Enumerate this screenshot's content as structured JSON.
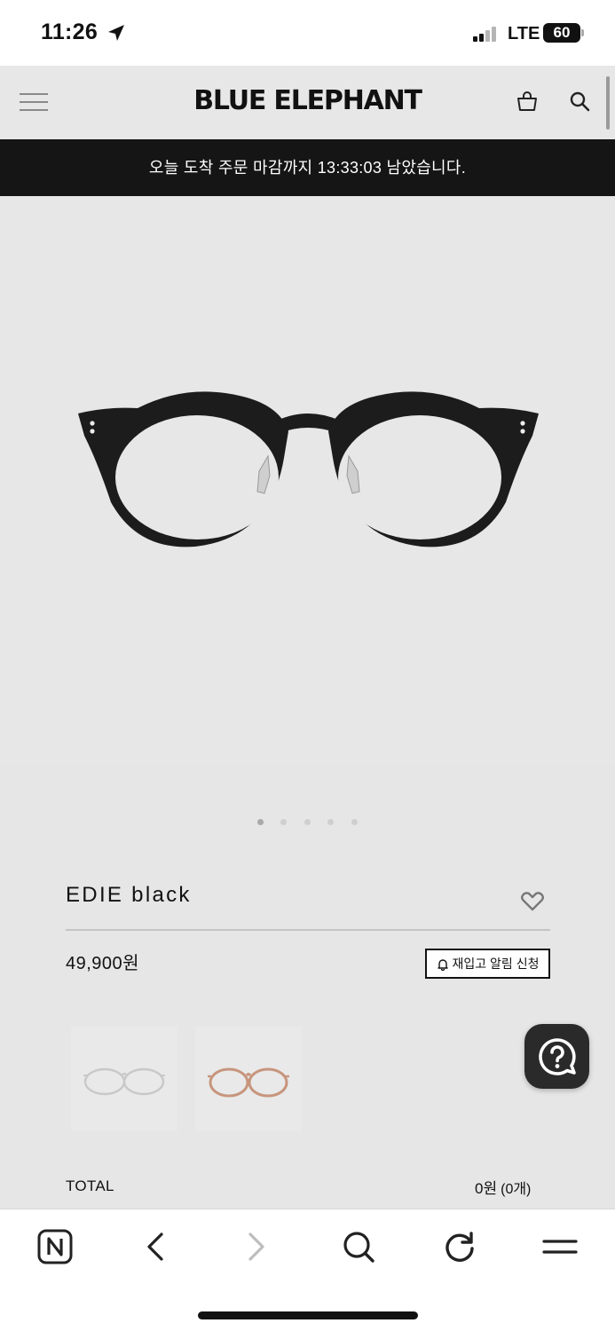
{
  "status_bar": {
    "time": "11:26",
    "network": "LTE",
    "battery": "60"
  },
  "header": {
    "brand": "BLUE ELEPHANT",
    "icons": [
      "menu-icon",
      "shopping-bag-icon",
      "search-icon"
    ]
  },
  "banner": {
    "text": "오늘 도착 주문 마감까지 13:33:03 남았습니다."
  },
  "gallery": {
    "image_count": 5,
    "active_index": 0
  },
  "product": {
    "name": "EDIE black",
    "price": "49,900원",
    "restock_label": "재입고 알림 신청",
    "color_options": [
      "clear",
      "brown"
    ]
  },
  "summary": {
    "total_label": "TOTAL",
    "total_value": "0원",
    "total_count": "(0개)"
  },
  "colors": {
    "banner_bg": "#151515",
    "page_bg": "#e6e6e6",
    "accent": "#111111"
  },
  "browser_toolbar": {
    "icons": [
      "naver-home-icon",
      "back-icon",
      "forward-icon",
      "search-icon",
      "reload-icon",
      "menu-icon"
    ]
  }
}
